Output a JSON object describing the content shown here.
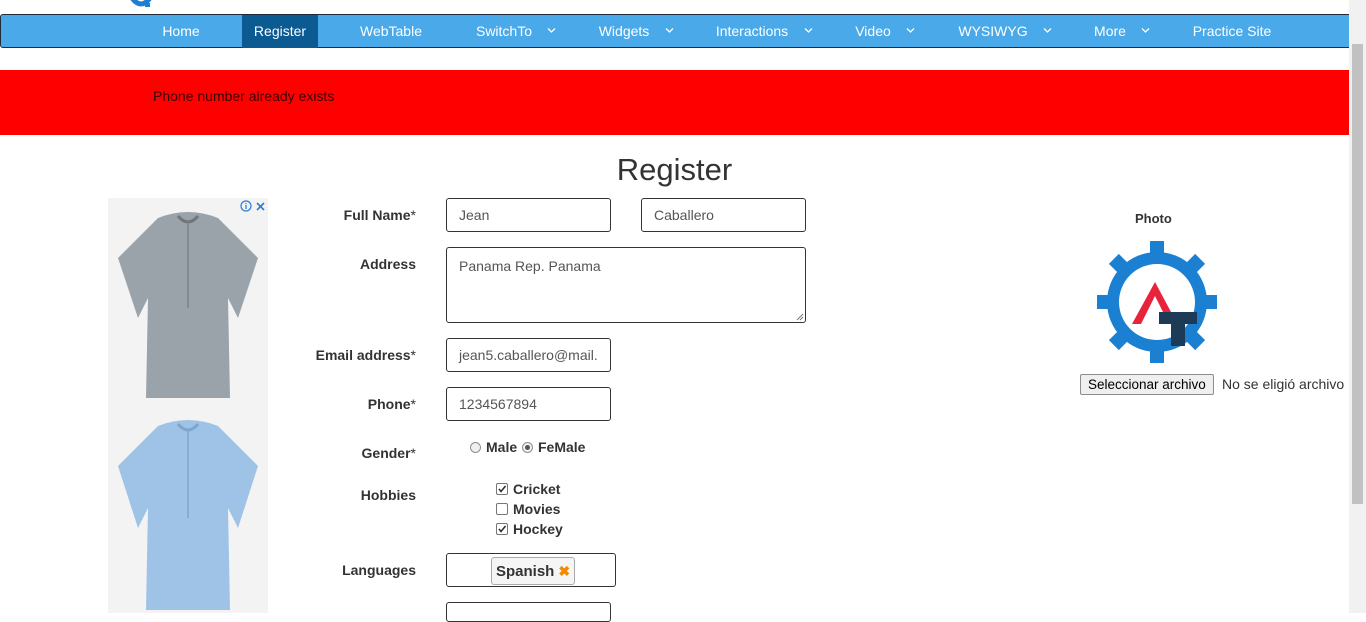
{
  "colors": {
    "navbar": "#4aa9e9",
    "nav_active": "#0c5a92",
    "alert": "#ff0000",
    "logo_blue": "#1b7fd2",
    "logo_red": "#e8243c",
    "logo_dark": "#1d3a56"
  },
  "nav": {
    "items": [
      {
        "label": "Home"
      },
      {
        "label": "Register"
      },
      {
        "label": "WebTable"
      },
      {
        "label": "SwitchTo"
      },
      {
        "label": "Widgets"
      },
      {
        "label": "Interactions"
      },
      {
        "label": "Video"
      },
      {
        "label": "WYSIWYG"
      },
      {
        "label": "More"
      },
      {
        "label": "Practice Site"
      }
    ]
  },
  "alert": {
    "message": "Phone number already exists"
  },
  "page": {
    "title": "Register"
  },
  "form": {
    "full_name_label": "Full Name",
    "first_name": "Jean",
    "last_name": "Caballero",
    "address_label": "Address",
    "address": "Panama Rep. Panama",
    "email_label": "Email address",
    "email": "jean5.caballero@mail.",
    "phone_label": "Phone",
    "phone": "1234567894",
    "gender_label": "Gender",
    "gender_options": [
      "Male",
      "FeMale"
    ],
    "gender_selected": "FeMale",
    "hobbies_label": "Hobbies",
    "hobbies": [
      {
        "label": "Cricket",
        "checked": true
      },
      {
        "label": "Movies",
        "checked": false
      },
      {
        "label": "Hockey",
        "checked": true
      }
    ],
    "languages_label": "Languages",
    "languages_selected": "Spanish",
    "required_mark": "*"
  },
  "photo": {
    "label": "Photo",
    "file_button": "Seleccionar archivo",
    "file_status": "No se eligió archivo"
  },
  "ad": {
    "icons": [
      "info-icon",
      "close-icon"
    ]
  }
}
